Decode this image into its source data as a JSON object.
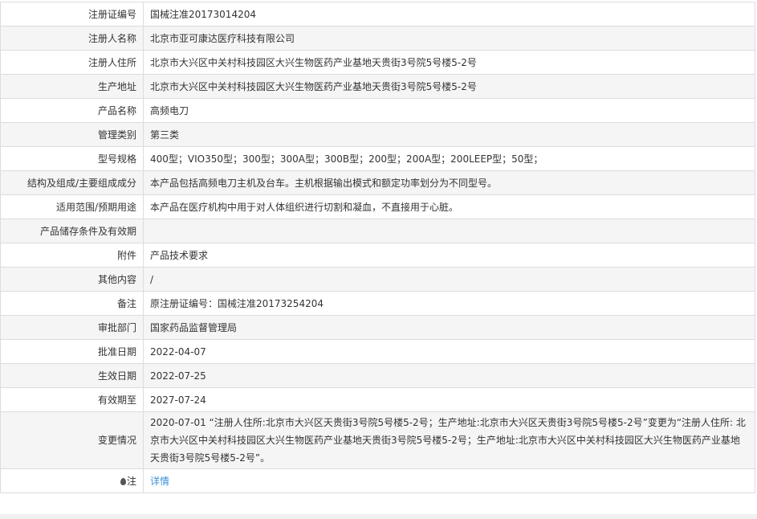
{
  "rows": [
    {
      "label": "注册证编号",
      "value": "国械注准20173014204"
    },
    {
      "label": "注册人名称",
      "value": "北京市亚可康达医疗科技有限公司"
    },
    {
      "label": "注册人住所",
      "value": "北京市大兴区中关村科技园区大兴生物医药产业基地天贵街3号院5号楼5-2号"
    },
    {
      "label": "生产地址",
      "value": "北京市大兴区中关村科技园区大兴生物医药产业基地天贵街3号院5号楼5-2号"
    },
    {
      "label": "产品名称",
      "value": "高频电刀"
    },
    {
      "label": "管理类别",
      "value": "第三类"
    },
    {
      "label": "型号规格",
      "value": "400型；VIO350型；300型；300A型；300B型；200型；200A型；200LEEP型；50型；"
    },
    {
      "label": "结构及组成/主要组成成分",
      "value": "本产品包括高频电刀主机及台车。主机根据输出模式和额定功率划分为不同型号。"
    },
    {
      "label": "适用范围/预期用途",
      "value": "本产品在医疗机构中用于对人体组织进行切割和凝血，不直接用于心脏。"
    },
    {
      "label": "产品储存条件及有效期",
      "value": ""
    },
    {
      "label": "附件",
      "value": "产品技术要求"
    },
    {
      "label": "其他内容",
      "value": "/"
    },
    {
      "label": "备注",
      "value": "原注册证编号：国械注准20173254204"
    },
    {
      "label": "审批部门",
      "value": "国家药品监督管理局"
    },
    {
      "label": "批准日期",
      "value": "2022-04-07"
    },
    {
      "label": "生效日期",
      "value": "2022-07-25"
    },
    {
      "label": "有效期至",
      "value": "2027-07-24"
    },
    {
      "label": "变更情况",
      "value": "2020-07-01 “注册人住所:北京市大兴区天贵街3号院5号楼5-2号；生产地址:北京市大兴区天贵街3号院5号楼5-2号”变更为“注册人住所: 北京市大兴区中关村科技园区大兴生物医药产业基地天贵街3号院5号楼5-2号；生产地址:北京市大兴区中关村科技园区大兴生物医药产业基地天贵街3号院5号楼5-2号”。"
    }
  ],
  "note": {
    "label": "注",
    "link": "详情"
  }
}
